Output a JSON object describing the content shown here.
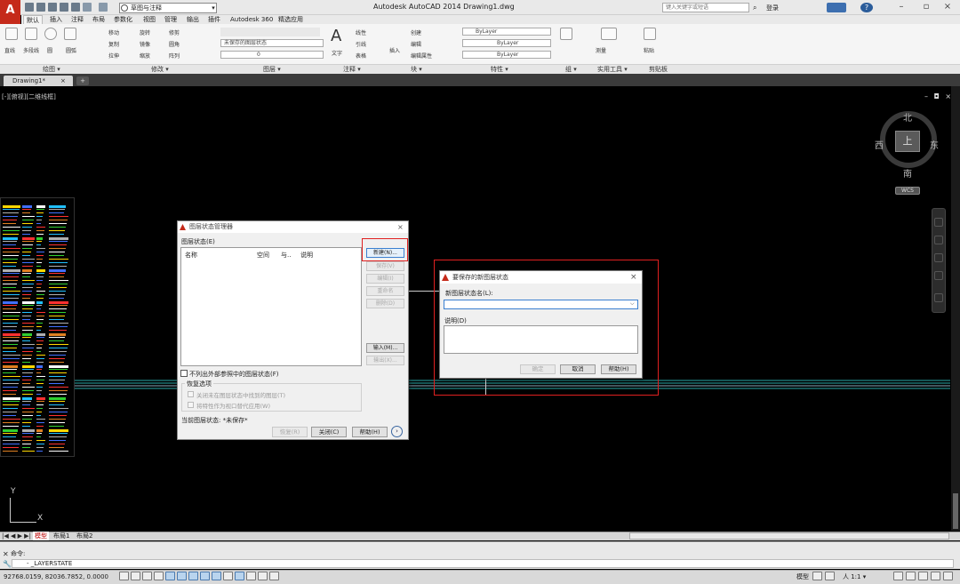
{
  "app": {
    "logo": "A",
    "title": "Autodesk AutoCAD 2014    Drawing1.dwg",
    "workspace": "草图与注释",
    "search_placeholder": "键入关键字或短语",
    "login": "登录"
  },
  "ribbon_tabs": [
    "默认",
    "插入",
    "注释",
    "布局",
    "参数化",
    "视图",
    "管理",
    "输出",
    "插件",
    "Autodesk 360",
    "精选应用"
  ],
  "ribbon": {
    "draw_tools": [
      "直线",
      "多段线",
      "圆",
      "圆弧"
    ],
    "modify_tools": [
      "移动",
      "旋转",
      "修剪",
      "复制",
      "镜像",
      "圆角",
      "拉伸",
      "缩放",
      "阵列"
    ],
    "layer_state": "未保存的图层状态",
    "layer_current": "0",
    "annotation_tools": [
      "线性",
      "引线",
      "表格"
    ],
    "text_label": "文字",
    "block_tools": [
      "创建",
      "编辑",
      "编辑属性"
    ],
    "insert_label": "插入",
    "bylayer": [
      "ByLayer",
      "ByLayer",
      "ByLayer"
    ],
    "measure_label": "测量",
    "paste_label": "粘贴",
    "panels": [
      "绘图 ▾",
      "修改 ▾",
      "图层 ▾",
      "注释 ▾",
      "块 ▾",
      "特性 ▾",
      "组 ▾",
      "实用工具 ▾",
      "剪贴板"
    ]
  },
  "doc_tab": {
    "label": "Drawing1*",
    "close": "×",
    "new": "+"
  },
  "viewport_label": "[-][俯视][二维线框]",
  "viewport_controls": "– ◘ ×",
  "viewcube": {
    "top": "上",
    "north": "北",
    "south": "南",
    "east": "东",
    "west": "西",
    "wcs": "WCS"
  },
  "ucs": {
    "x": "X",
    "y": "Y"
  },
  "layout_tabs": {
    "nav": "|◀ ◀ ▶ ▶|",
    "model": "模型",
    "layout1": "布局1",
    "layout2": "布局2"
  },
  "command": {
    "history": "命令:",
    "current": "- _LAYERSTATE"
  },
  "status": {
    "coords": "92768.0159, 82036.7852, 0.0000",
    "model": "模型",
    "scale": "人 1:1 ▾"
  },
  "layer_state_manager": {
    "title": "图层状态管理器",
    "close": "×",
    "list_label": "图层状态(E)",
    "columns": [
      "名称",
      "空间",
      "与..",
      "说明"
    ],
    "buttons": {
      "new": "新建(N)...",
      "save": "保存(V)",
      "edit": "编辑(I)",
      "rename": "重命名",
      "delete": "删除(D)",
      "import": "输入(M)...",
      "export": "输出(X)..."
    },
    "exclude_xref": "不列出外部参照中的图层状态(F)",
    "restore_group": "恢复选项",
    "restore_opts": [
      "关闭未在图层状态中找到的图层(T)",
      "将特性作为视口替代应用(W)"
    ],
    "current_state": "当前图层状态:  *未保存*",
    "bottom_buttons": {
      "restore": "恢复(R)",
      "close": "关闭(C)",
      "help": "帮助(H)"
    },
    "more": "›"
  },
  "new_layer_state": {
    "title": "要保存的新图层状态",
    "close": "×",
    "name_label": "新图层状态名(L):",
    "name_value": "",
    "desc_label": "说明(D)",
    "desc_value": "",
    "ok": "确定",
    "cancel": "取消",
    "help": "帮助(H)"
  },
  "colors": {
    "highlight": "#e02020",
    "accent": "#3a7fd0",
    "model_tab": "#b00000"
  }
}
